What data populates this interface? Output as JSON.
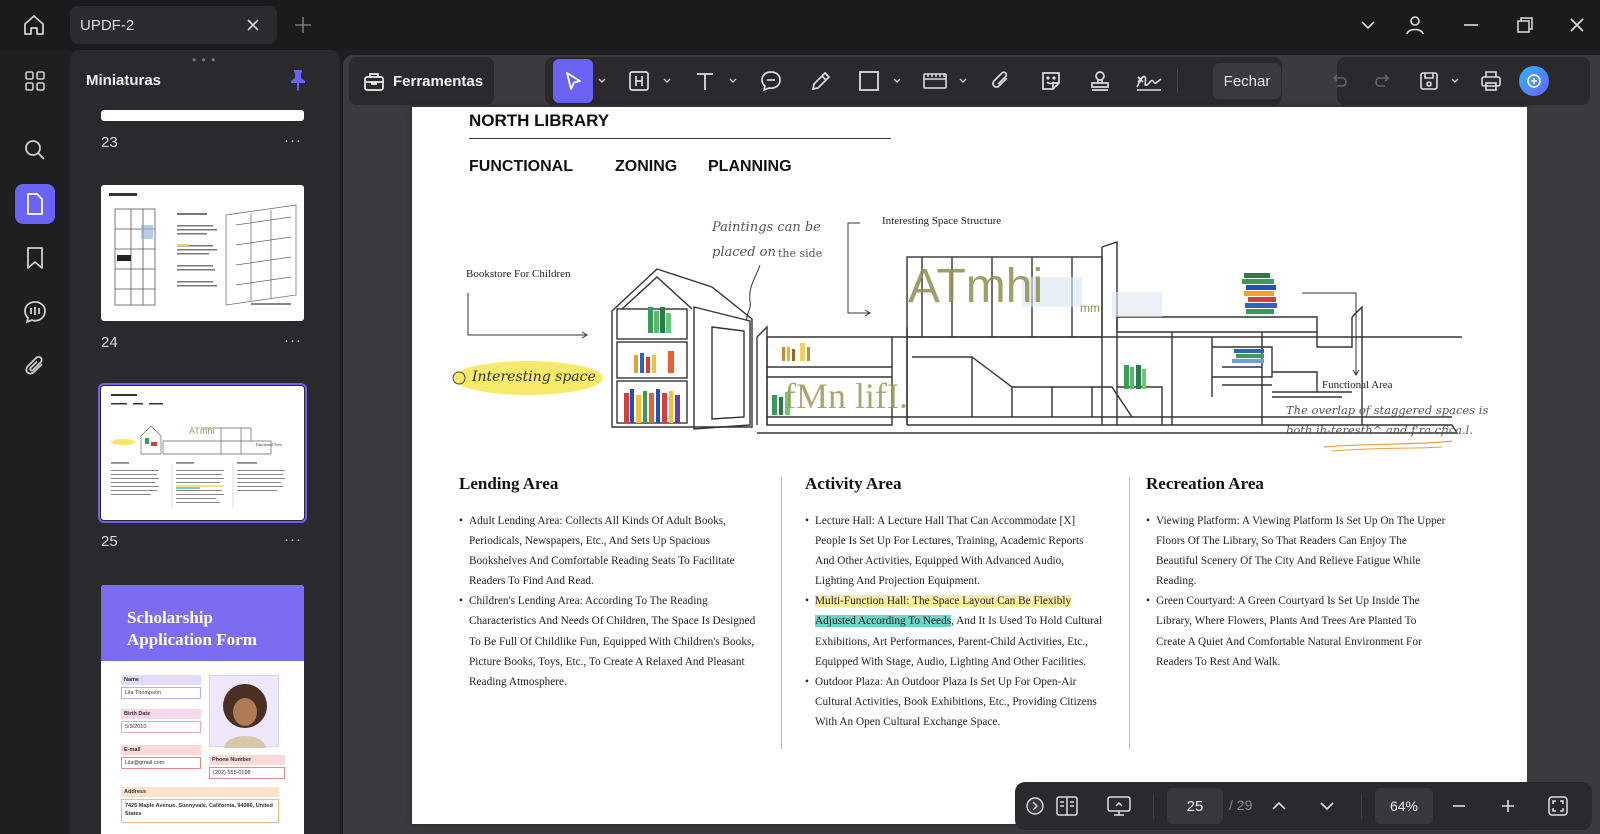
{
  "tab": {
    "title": "UPDF-2"
  },
  "thumbnails": {
    "title": "Miniaturas",
    "pages": [
      {
        "num": "23",
        "more": "···"
      },
      {
        "num": "24",
        "more": "···"
      },
      {
        "num": "25",
        "more": "···"
      },
      {
        "title_line1": "Scholarship",
        "title_line2": "Application Form",
        "name_label": "Name",
        "name_value": "Lila Thompson",
        "dob_label": "Birth Date",
        "dob_value": "5/9/2010",
        "email_label": "E-mail",
        "email_value": "Lila@gmail.com",
        "phone_label": "Phone Number",
        "phone_value": "(202) 555-0198",
        "address_label": "Address",
        "address_value": "7425 Maple Avenue, Sunnyvale, California, 94086, United States"
      }
    ]
  },
  "toolbar": {
    "tools_label": "Ferramentas",
    "close_label": "Fechar"
  },
  "page": {
    "heading": "NORTH LIBRARY",
    "sub1": "FUNCTIONAL",
    "sub2": "ZONING",
    "sub3": "PLANNING",
    "illustration": {
      "paintings_note_1": "Paintings can be",
      "paintings_note_2": "placed on",
      "paintings_note_3": "the side",
      "interesting_structure": "Interesting Space Structure",
      "bookstore_label": "Bookstore For Children",
      "interesting_space": "Interesting space",
      "functional_area": "Functional Area",
      "overlap_note_1": "The overlap of staggered spaces is",
      "overlap_note_2": "both ih-teresth^ and f'ra.cfica.l.",
      "garbled_1": "ATmhi",
      "garbled_1b": "mm",
      "garbled_2": "fMn lifI."
    },
    "sections": [
      {
        "title": "Lending Area",
        "items": [
          "Adult Lending Area: Collects All Kinds Of Adult Books, Periodicals, Newspapers, Etc., And Sets Up Spacious Bookshelves And Comfortable Reading Seats To Facilitate Readers To Find And Read.",
          "Children's Lending Area: According To The Reading Characteristics And Needs Of Children, The Space Is Designed To Be Full Of Childlike Fun, Equipped With Children's Books, Picture Books, Toys, Etc., To Create A Relaxed And Pleasant Reading Atmosphere."
        ]
      },
      {
        "title": "Activity Area",
        "item1": "Lecture Hall: A Lecture Hall That Can Accommodate [X] People Is Set Up For Lectures, Training, Academic Reports And Other Activities, Equipped With Advanced Audio, Lighting And Projection Equipment.",
        "item2_hl_yellow": "Multi-Function Hall: The Space Layout Can Be Flexibly",
        "item2_hl_teal": "Adjusted According To Needs",
        "item2_rest": ", And It Is Used To Hold Cultural Exhibitions, Art Performances, Parent-Child Activities, Etc., Equipped With Stage, Audio, Lighting And Other Facilities.",
        "item3": "Outdoor Plaza: An Outdoor Plaza Is Set Up For Open-Air Cultural Activities, Book Exhibitions, Etc., Providing Citizens With An Open Cultural Exchange Space."
      },
      {
        "title": "Recreation Area",
        "items": [
          "Viewing Platform: A Viewing Platform Is Set Up On The Upper Floors Of The Library, So That Readers Can Enjoy The Beautiful Scenery Of The City And Relieve Fatigue While Reading.",
          "Green Courtyard: A Green Courtyard Is Set Up Inside The Library, Where Flowers, Plants And Trees Are Planted To Create A Quiet And Comfortable Natural Environment For Readers To Rest And Walk."
        ]
      }
    ]
  },
  "navigation": {
    "current_page": "25",
    "total_pages": "/ 29",
    "zoom": "64%"
  },
  "colors": {
    "accent": "#6a63f5",
    "highlight_yellow": "#f7f0a0",
    "highlight_teal": "#6ed4c4"
  }
}
